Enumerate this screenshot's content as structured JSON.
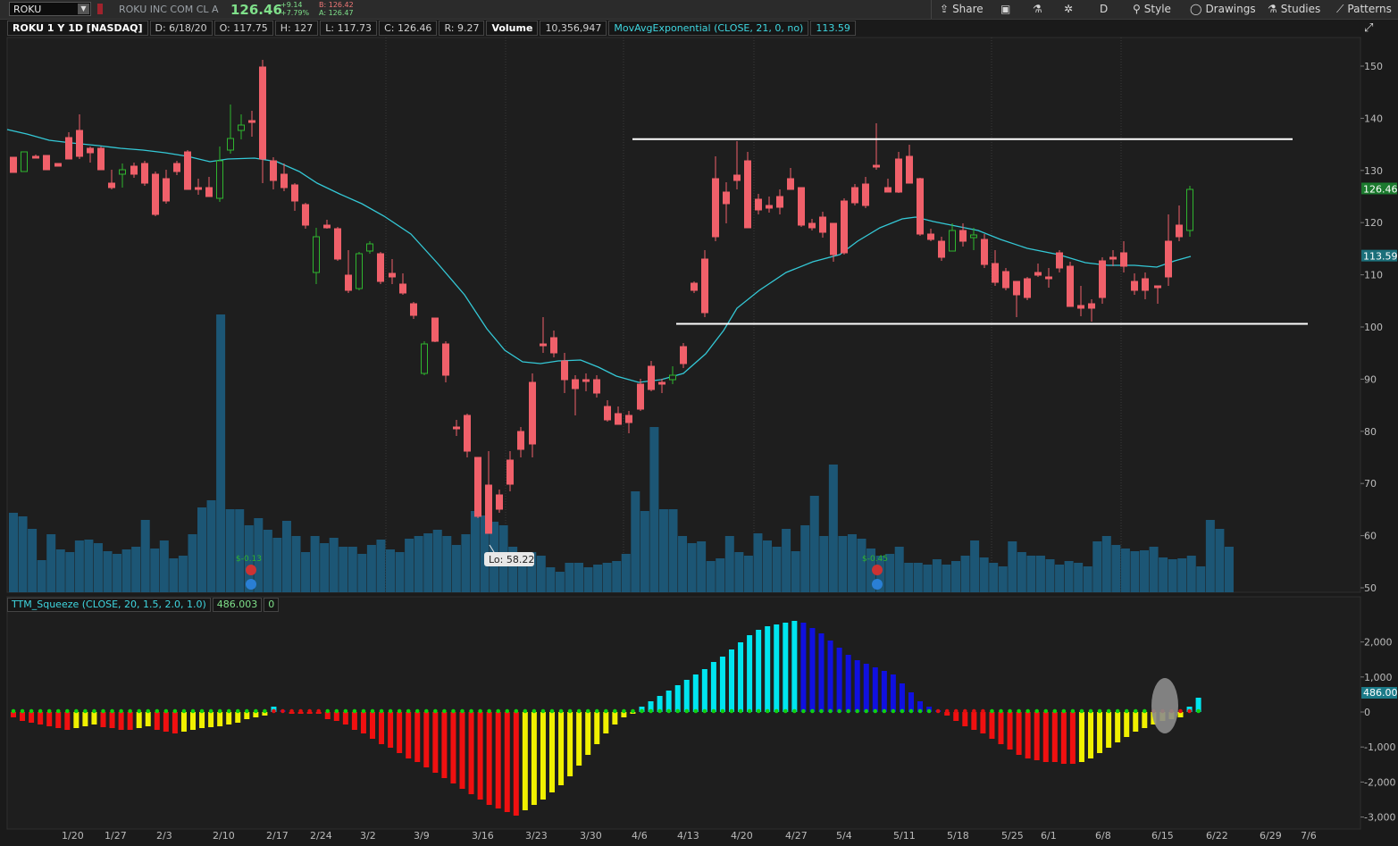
{
  "toolbar": {
    "symbol": "ROKU",
    "company": "ROKU INC COM CL A",
    "last": "126.46",
    "net_change": "+9.14",
    "pct_change": "+7.79%",
    "bid": "B: 126.42",
    "ask": "A: 126.47",
    "share_label": "Share",
    "timeframe_label": "D",
    "style_label": "Style",
    "drawings_label": "Drawings",
    "studies_label": "Studies",
    "patterns_label": "Patterns"
  },
  "info_bar": {
    "title": "ROKU 1 Y 1D [NASDAQ]",
    "date": "D: 6/18/20",
    "open": "O: 117.75",
    "high": "H: 127",
    "low": "L: 117.73",
    "close": "C: 126.46",
    "range": "R: 9.27",
    "volume_label": "Volume",
    "volume_value": "10,356,947",
    "ema_label": "MovAvgExponential (CLOSE, 21, 0, no)",
    "ema_value": "113.59"
  },
  "lower_bar": {
    "study_label": "TTM_Squeeze (CLOSE, 20, 1.5, 2.0, 1.0)",
    "value": "486.003",
    "alert": "0"
  },
  "chart_data": [
    {
      "type": "candlestick",
      "y_ticks": [
        50,
        60,
        70,
        80,
        90,
        100,
        110,
        120,
        130,
        140,
        150
      ],
      "ylim": [
        50,
        153
      ],
      "x_ticks": [
        "1/20",
        "1/27",
        "2/3",
        "2/10",
        "2/17",
        "2/24",
        "3/2",
        "3/9",
        "3/16",
        "3/23",
        "3/30",
        "4/6",
        "4/13",
        "4/20",
        "4/27",
        "5/4",
        "5/11",
        "5/18",
        "5/25",
        "6/1",
        "6/8",
        "6/15",
        "6/22",
        "6/29",
        "7/6"
      ],
      "last_price_label": "126.46",
      "ema_price_label": "113.59",
      "low_callout": "Lo: 58.22",
      "earnings_labels": [
        "$-0.13",
        "$-0.45"
      ],
      "resistance_level": 136,
      "support_level": 100.6,
      "colors": {
        "up": "#2fb52f",
        "down": "#f0606a",
        "ema": "#34c8d6",
        "volume": "#1c5675"
      }
    },
    {
      "type": "histogram",
      "title": "TTM_Squeeze",
      "y_ticks": [
        2000,
        1000,
        0,
        -1000,
        -2000,
        -3000
      ],
      "y_tick_labels": [
        "2,000",
        "1,000",
        "0",
        "-1,000",
        "-2,000",
        "-3,000"
      ],
      "ylim": [
        -3100,
        2600
      ],
      "current_value_label": "486.003",
      "colors": {
        "pos_up": "#00e5f0",
        "pos_down": "#1010e0",
        "neg_down": "#f01010",
        "neg_up": "#f0f000",
        "squeeze_on": "#e01010",
        "squeeze_off": "#10d010"
      }
    }
  ]
}
